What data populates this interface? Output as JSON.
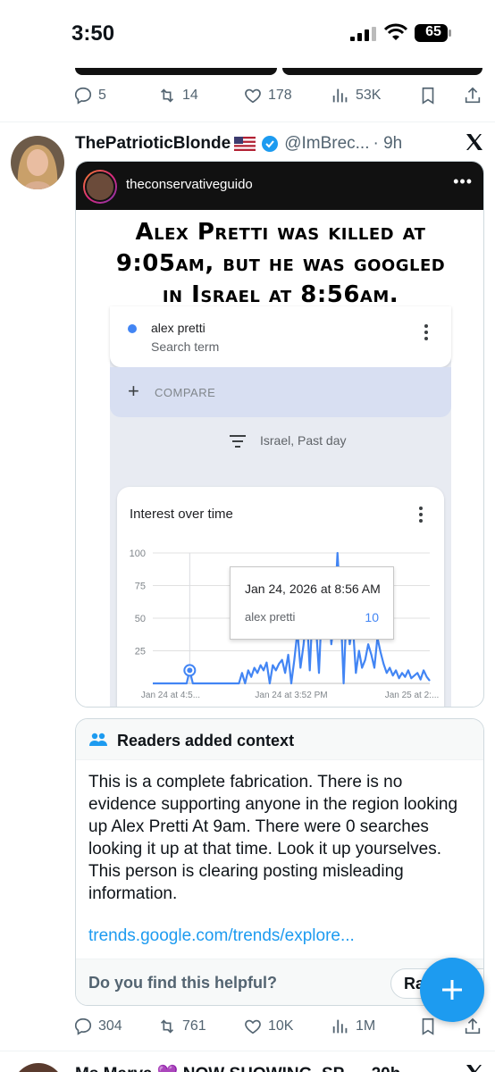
{
  "status_bar": {
    "time": "3:50",
    "battery": "65"
  },
  "prev_tweet": {
    "replies": "5",
    "retweets": "14",
    "likes": "178",
    "views": "53K"
  },
  "tweet": {
    "display_name": "ThePatrioticBlonde",
    "handle": "@ImBrec...",
    "time": "· 9h",
    "media": {
      "ig_username": "theconservativeguido",
      "ig_more": "•••",
      "headline_line1": "Alex Pretti was killed at",
      "headline_line2": "9:05am, but he was googled",
      "headline_line3": "in Israel at 8:56am.",
      "trends": {
        "search_term": "alex pretti",
        "search_sub": "Search term",
        "compare_label": "COMPARE",
        "filter_label": "Israel, Past day",
        "chart_title": "Interest over time",
        "tooltip_date": "Jan 24, 2026 at 8:56 AM",
        "tooltip_term": "alex pretti",
        "tooltip_value": "10"
      }
    },
    "note": {
      "header": "Readers added context",
      "body": "This is a complete fabrication. There is no evidence supporting anyone in the region looking up Alex Pretti At 9am. There were 0 searches looking it up at that time.  Look it up yourselves. This person is clearing posting misleading information.",
      "link": "trends.google.com/trends/explore...",
      "helpful_prompt": "Do you find this helpful?",
      "rate_label": "Ra"
    },
    "replies": "304",
    "retweets": "761",
    "likes": "10K",
    "views": "1M"
  },
  "next_tweet": {
    "display_name": "Ms Marva 💜 NOW SHOWING. SP... · 20h"
  },
  "colors": {
    "accent": "#1d9bf0",
    "muted": "#536471",
    "trends_blue": "#4285f4"
  },
  "chart_data": {
    "type": "line",
    "title": "Interest over time",
    "x_tick_labels": [
      "Jan 24 at 4:5...",
      "Jan 24 at 3:52 PM",
      "Jan 25 at 2:..."
    ],
    "y_tick_labels": [
      "100",
      "75",
      "50",
      "25"
    ],
    "ylim": [
      0,
      100
    ],
    "series": [
      {
        "name": "alex pretti",
        "values": [
          0,
          0,
          0,
          0,
          0,
          0,
          0,
          0,
          0,
          0,
          0,
          0,
          10,
          0,
          0,
          0,
          0,
          0,
          0,
          0,
          0,
          0,
          0,
          0,
          0,
          0,
          0,
          0,
          0,
          8,
          0,
          10,
          5,
          12,
          8,
          14,
          10,
          16,
          0,
          14,
          10,
          15,
          18,
          8,
          22,
          0,
          18,
          40,
          12,
          30,
          55,
          10,
          60,
          45,
          8,
          62,
          38,
          70,
          30,
          50,
          100,
          60,
          0,
          60,
          30,
          45,
          8,
          25,
          12,
          18,
          30,
          22,
          12,
          35,
          24,
          15,
          8,
          12,
          6,
          10,
          4,
          8,
          5,
          10,
          4,
          6,
          8,
          3,
          10,
          5,
          2
        ]
      }
    ],
    "highlight": {
      "index": 12,
      "label": "Jan 24, 2026 at 8:56 AM",
      "value": 10
    },
    "grid": true
  }
}
